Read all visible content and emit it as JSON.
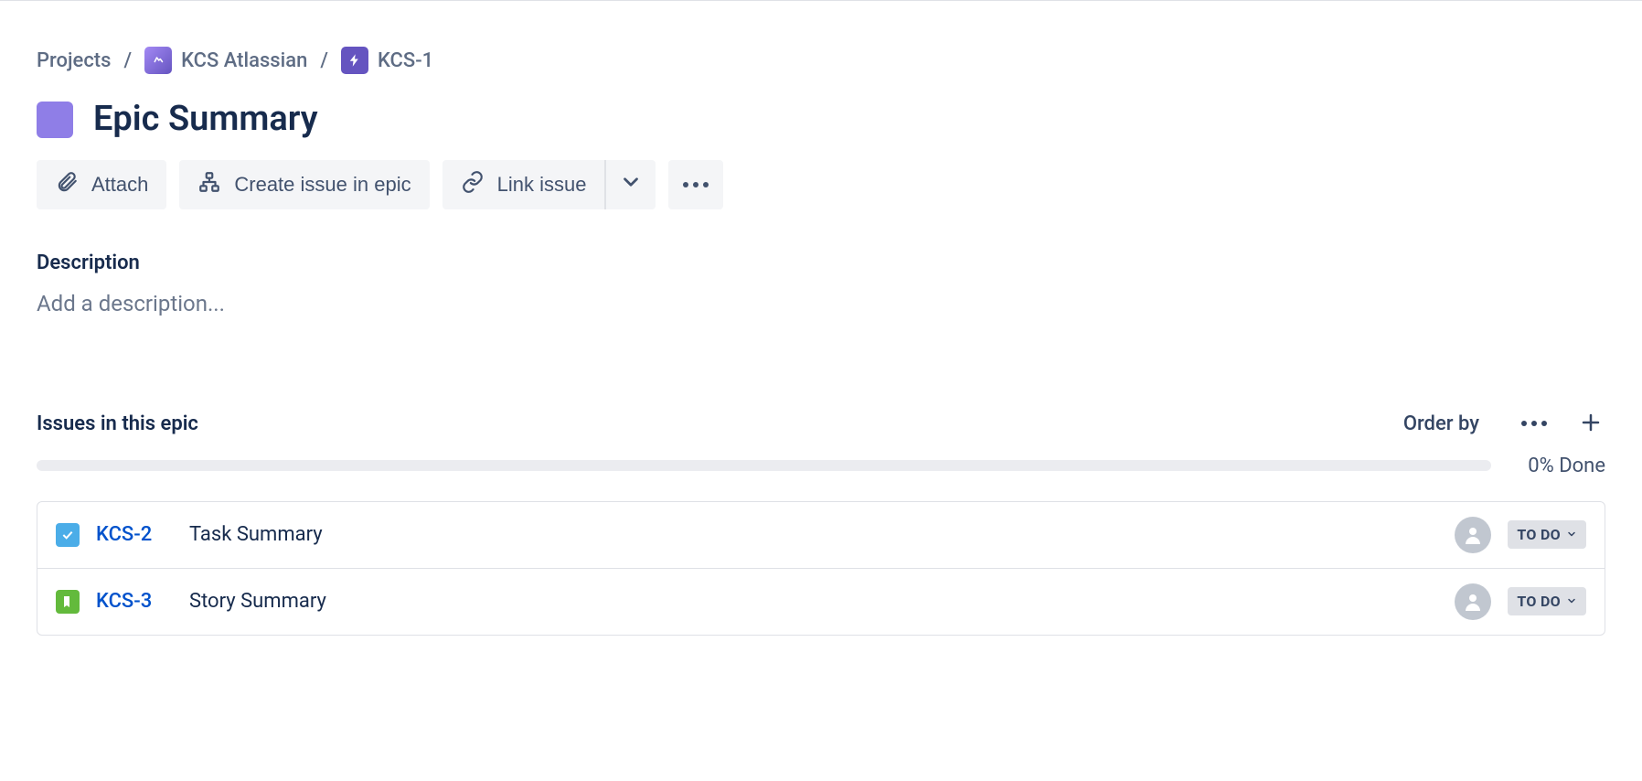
{
  "breadcrumb": {
    "projects_label": "Projects",
    "project_name": "KCS Atlassian",
    "issue_key": "KCS-1"
  },
  "title": "Epic Summary",
  "actions": {
    "attach": "Attach",
    "create_in_epic": "Create issue in epic",
    "link_issue": "Link issue"
  },
  "description": {
    "heading": "Description",
    "placeholder": "Add a description..."
  },
  "issues_section": {
    "heading": "Issues in this epic",
    "order_by_label": "Order by",
    "progress_percent": 0,
    "progress_text": "0% Done"
  },
  "issues": [
    {
      "type": "task",
      "key": "KCS-2",
      "summary": "Task Summary",
      "status": "TO DO"
    },
    {
      "type": "story",
      "key": "KCS-3",
      "summary": "Story Summary",
      "status": "TO DO"
    }
  ]
}
